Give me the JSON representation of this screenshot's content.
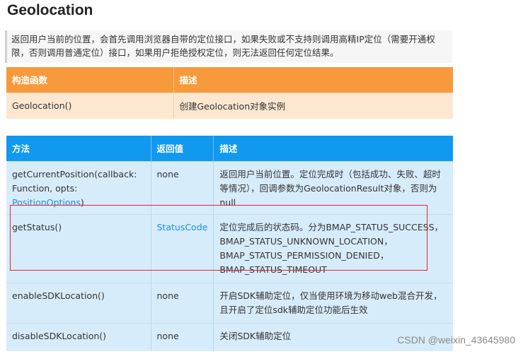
{
  "title": "Geolocation",
  "description": "返回用户当前的位置，会首先调用浏览器自带的定位接口，如果失败或不支持则调用高精IP定位（需要开通权限，否则调用普通定位）接口，如果用户拒绝授权定位，则无法返回任何定位结果。",
  "constructor_table": {
    "headers": [
      "构造函数",
      "描述"
    ],
    "rows": [
      {
        "name": "Geolocation()",
        "desc": "创建Geolocation对象实例"
      }
    ]
  },
  "method_table": {
    "headers": [
      "方法",
      "返回值",
      "描述"
    ],
    "rows": [
      {
        "method_a": "getCurrentPosition(callback: Function, opts: ",
        "method_link": "PositionOptions",
        "method_b": ")",
        "returns": "none",
        "returns_link": "",
        "desc": "返回用户当前位置。定位完成时（包括成功、失败、超时等情况），回调参数为GeolocationResult对象，否则为null"
      },
      {
        "method_a": "getStatus()",
        "method_link": "",
        "method_b": "",
        "returns": "",
        "returns_link": "StatusCode",
        "desc": "定位完成后的状态码。分为BMAP_STATUS_SUCCESS，BMAP_STATUS_UNKNOWN_LOCATION，BMAP_STATUS_PERMISSION_DENIED，BMAP_STATUS_TIMEOUT"
      },
      {
        "method_a": "enableSDKLocation()",
        "method_link": "",
        "method_b": "",
        "returns": "none",
        "returns_link": "",
        "desc": "开启SDK辅助定位，仅当使用环境为移动web混合开发，且开启了定位sdk辅助定位功能后生效"
      },
      {
        "method_a": "disableSDKLocation()",
        "method_link": "",
        "method_b": "",
        "returns": "none",
        "returns_link": "",
        "desc": "关闭SDK辅助定位"
      }
    ]
  },
  "watermark": "CSDN @weixin_43645980",
  "colors": {
    "orange_header": "#f79a3b",
    "orange_row": "#fde7d0",
    "blue_header": "#1199f0",
    "blue_row": "#d7ecfb",
    "link": "#1a8ee0",
    "highlight_box": "#e4232f"
  }
}
